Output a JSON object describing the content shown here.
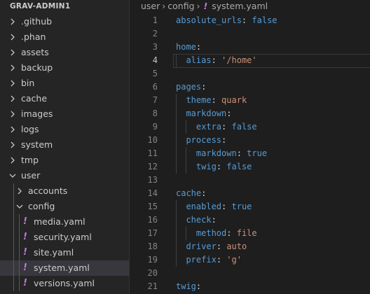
{
  "sidebar": {
    "title": "GRAV-ADMIN1",
    "items": [
      {
        "label": ".github",
        "type": "folder",
        "expanded": false,
        "depth": 0
      },
      {
        "label": ".phan",
        "type": "folder",
        "expanded": false,
        "depth": 0
      },
      {
        "label": "assets",
        "type": "folder",
        "expanded": false,
        "depth": 0
      },
      {
        "label": "backup",
        "type": "folder",
        "expanded": false,
        "depth": 0
      },
      {
        "label": "bin",
        "type": "folder",
        "expanded": false,
        "depth": 0
      },
      {
        "label": "cache",
        "type": "folder",
        "expanded": false,
        "depth": 0
      },
      {
        "label": "images",
        "type": "folder",
        "expanded": false,
        "depth": 0
      },
      {
        "label": "logs",
        "type": "folder",
        "expanded": false,
        "depth": 0
      },
      {
        "label": "system",
        "type": "folder",
        "expanded": false,
        "depth": 0
      },
      {
        "label": "tmp",
        "type": "folder",
        "expanded": false,
        "depth": 0
      },
      {
        "label": "user",
        "type": "folder",
        "expanded": true,
        "depth": 0
      },
      {
        "label": "accounts",
        "type": "folder",
        "expanded": false,
        "depth": 1
      },
      {
        "label": "config",
        "type": "folder",
        "expanded": true,
        "depth": 1
      },
      {
        "label": "media.yaml",
        "type": "yaml",
        "depth": 2
      },
      {
        "label": "security.yaml",
        "type": "yaml",
        "depth": 2
      },
      {
        "label": "site.yaml",
        "type": "yaml",
        "depth": 2
      },
      {
        "label": "system.yaml",
        "type": "yaml",
        "depth": 2,
        "selected": true
      },
      {
        "label": "versions.yaml",
        "type": "yaml",
        "depth": 2
      }
    ]
  },
  "breadcrumb": {
    "parts": [
      "user",
      "config"
    ],
    "file_icon": "!",
    "file": "system.yaml"
  },
  "editor": {
    "active_line": 4,
    "lines": [
      {
        "n": "1",
        "indent": 0,
        "key": "absolute_urls",
        "value": "false",
        "vtype": "b"
      },
      {
        "n": "2",
        "indent": 0
      },
      {
        "n": "3",
        "indent": 0,
        "key": "home"
      },
      {
        "n": "4",
        "indent": 1,
        "key": "alias",
        "value": "'/home'",
        "vtype": "s"
      },
      {
        "n": "5",
        "indent": 0
      },
      {
        "n": "6",
        "indent": 0,
        "key": "pages"
      },
      {
        "n": "7",
        "indent": 1,
        "key": "theme",
        "value": "quark",
        "vtype": "s"
      },
      {
        "n": "8",
        "indent": 1,
        "key": "markdown"
      },
      {
        "n": "9",
        "indent": 2,
        "key": "extra",
        "value": "false",
        "vtype": "b"
      },
      {
        "n": "10",
        "indent": 1,
        "key": "process"
      },
      {
        "n": "11",
        "indent": 2,
        "key": "markdown",
        "value": "true",
        "vtype": "b"
      },
      {
        "n": "12",
        "indent": 2,
        "key": "twig",
        "value": "false",
        "vtype": "b"
      },
      {
        "n": "13",
        "indent": 0
      },
      {
        "n": "14",
        "indent": 0,
        "key": "cache"
      },
      {
        "n": "15",
        "indent": 1,
        "key": "enabled",
        "value": "true",
        "vtype": "b"
      },
      {
        "n": "16",
        "indent": 1,
        "key": "check"
      },
      {
        "n": "17",
        "indent": 2,
        "key": "method",
        "value": "file",
        "vtype": "s"
      },
      {
        "n": "18",
        "indent": 1,
        "key": "driver",
        "value": "auto",
        "vtype": "s"
      },
      {
        "n": "19",
        "indent": 1,
        "key": "prefix",
        "value": "'g'",
        "vtype": "s"
      },
      {
        "n": "20",
        "indent": 0
      },
      {
        "n": "21",
        "indent": 0,
        "key": "twig"
      }
    ]
  },
  "colors": {
    "key": "#569cd6",
    "string": "#ce9178",
    "boolean": "#569cd6",
    "yaml_icon": "#c678dd",
    "selected_bg": "#37373d"
  },
  "icons": {
    "folder_collapsed": "chevron-right-icon",
    "folder_expanded": "chevron-down-icon",
    "yaml_file": "yaml-exclamation-icon"
  }
}
